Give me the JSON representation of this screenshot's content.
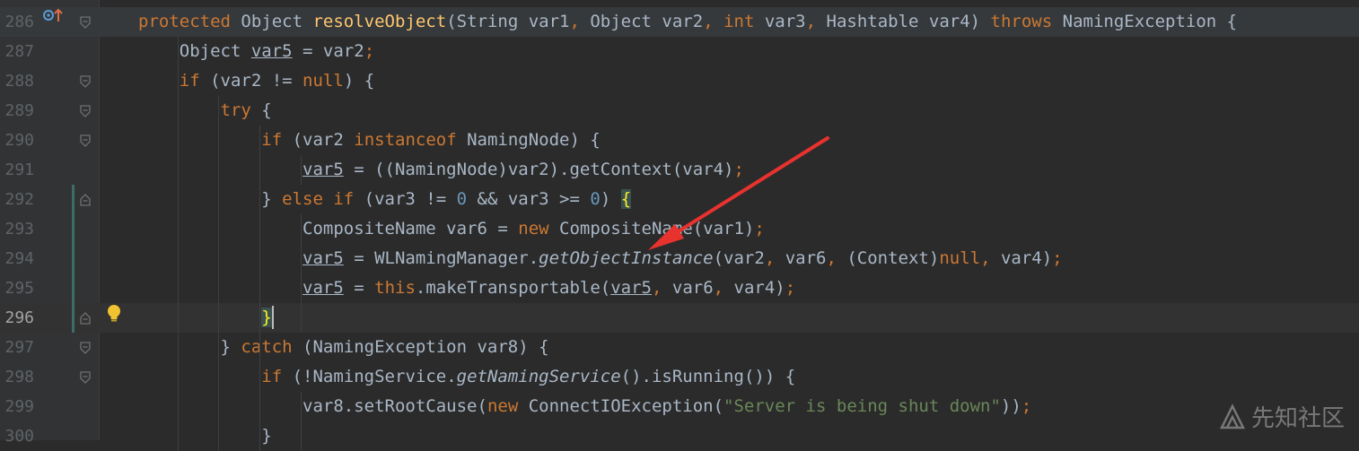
{
  "colors": {
    "background": "#2b2b2b",
    "gutter": "#313335",
    "keyword": "#cc7832",
    "function": "#ffc66d",
    "number": "#6897bb",
    "string": "#6a8759",
    "text": "#a9b7c6",
    "arrow": "#e8322e"
  },
  "lines": [
    {
      "num": "286",
      "tokens": [
        {
          "t": "protected ",
          "c": "kw"
        },
        {
          "t": "Object ",
          "c": "default"
        },
        {
          "t": "resolveObject",
          "c": "fn"
        },
        {
          "t": "(String var1",
          "c": "default"
        },
        {
          "t": ", ",
          "c": "kw"
        },
        {
          "t": "Object var2",
          "c": "default"
        },
        {
          "t": ", ",
          "c": "kw"
        },
        {
          "t": "int ",
          "c": "kw"
        },
        {
          "t": "var3",
          "c": "default"
        },
        {
          "t": ", ",
          "c": "kw"
        },
        {
          "t": "Hashtable var4) ",
          "c": "default"
        },
        {
          "t": "throws ",
          "c": "kw"
        },
        {
          "t": "NamingException {",
          "c": "default"
        }
      ]
    },
    {
      "num": "287",
      "tokens": [
        {
          "t": "    Object ",
          "c": "default"
        },
        {
          "t": "var5",
          "c": "ul"
        },
        {
          "t": " = var2",
          "c": "default"
        },
        {
          "t": ";",
          "c": "kw"
        }
      ]
    },
    {
      "num": "288",
      "tokens": [
        {
          "t": "    ",
          "c": "default"
        },
        {
          "t": "if ",
          "c": "kw"
        },
        {
          "t": "(var2 != ",
          "c": "default"
        },
        {
          "t": "null",
          "c": "kw"
        },
        {
          "t": ") {",
          "c": "default"
        }
      ]
    },
    {
      "num": "289",
      "tokens": [
        {
          "t": "        ",
          "c": "default"
        },
        {
          "t": "try ",
          "c": "kw"
        },
        {
          "t": "{",
          "c": "default"
        }
      ]
    },
    {
      "num": "290",
      "tokens": [
        {
          "t": "            ",
          "c": "default"
        },
        {
          "t": "if ",
          "c": "kw"
        },
        {
          "t": "(var2 ",
          "c": "default"
        },
        {
          "t": "instanceof ",
          "c": "kw"
        },
        {
          "t": "NamingNode) {",
          "c": "default"
        }
      ]
    },
    {
      "num": "291",
      "tokens": [
        {
          "t": "                ",
          "c": "default"
        },
        {
          "t": "var5",
          "c": "ul"
        },
        {
          "t": " = ((NamingNode)var2).getContext(var4)",
          "c": "default"
        },
        {
          "t": ";",
          "c": "kw"
        }
      ]
    },
    {
      "num": "292",
      "tokens": [
        {
          "t": "            } ",
          "c": "default"
        },
        {
          "t": "else if ",
          "c": "kw"
        },
        {
          "t": "(var3 != ",
          "c": "default"
        },
        {
          "t": "0",
          "c": "num"
        },
        {
          "t": " && var3 >= ",
          "c": "default"
        },
        {
          "t": "0",
          "c": "num"
        },
        {
          "t": ") ",
          "c": "default"
        },
        {
          "t": "{",
          "c": "match"
        }
      ]
    },
    {
      "num": "293",
      "tokens": [
        {
          "t": "                CompositeName var6 = ",
          "c": "default"
        },
        {
          "t": "new ",
          "c": "kw"
        },
        {
          "t": "CompositeName(var1)",
          "c": "default"
        },
        {
          "t": ";",
          "c": "kw"
        }
      ]
    },
    {
      "num": "294",
      "tokens": [
        {
          "t": "                ",
          "c": "default"
        },
        {
          "t": "var5",
          "c": "ul"
        },
        {
          "t": " = WLNamingManager.",
          "c": "default"
        },
        {
          "t": "getObjectInstance",
          "c": "it"
        },
        {
          "t": "(var2",
          "c": "default"
        },
        {
          "t": ", ",
          "c": "kw"
        },
        {
          "t": "var6",
          "c": "default"
        },
        {
          "t": ", ",
          "c": "kw"
        },
        {
          "t": "(Context)",
          "c": "default"
        },
        {
          "t": "null",
          "c": "kw"
        },
        {
          "t": ", ",
          "c": "kw"
        },
        {
          "t": "var4)",
          "c": "default"
        },
        {
          "t": ";",
          "c": "kw"
        }
      ]
    },
    {
      "num": "295",
      "tokens": [
        {
          "t": "                ",
          "c": "default"
        },
        {
          "t": "var5",
          "c": "ul"
        },
        {
          "t": " = ",
          "c": "default"
        },
        {
          "t": "this",
          "c": "kw"
        },
        {
          "t": ".makeTransportable(",
          "c": "default"
        },
        {
          "t": "var5",
          "c": "ul"
        },
        {
          "t": ", ",
          "c": "kw"
        },
        {
          "t": "var6",
          "c": "default"
        },
        {
          "t": ", ",
          "c": "kw"
        },
        {
          "t": "var4)",
          "c": "default"
        },
        {
          "t": ";",
          "c": "kw"
        }
      ]
    },
    {
      "num": "296",
      "tokens": [
        {
          "t": "            ",
          "c": "default"
        },
        {
          "t": "}",
          "c": "match"
        }
      ]
    },
    {
      "num": "297",
      "tokens": [
        {
          "t": "        } ",
          "c": "default"
        },
        {
          "t": "catch ",
          "c": "kw"
        },
        {
          "t": "(NamingException var8) {",
          "c": "default"
        }
      ]
    },
    {
      "num": "298",
      "tokens": [
        {
          "t": "            ",
          "c": "default"
        },
        {
          "t": "if ",
          "c": "kw"
        },
        {
          "t": "(!NamingService.",
          "c": "default"
        },
        {
          "t": "getNamingService",
          "c": "it"
        },
        {
          "t": "().isRunning()) {",
          "c": "default"
        }
      ]
    },
    {
      "num": "299",
      "tokens": [
        {
          "t": "                var8.setRootCause(",
          "c": "default"
        },
        {
          "t": "new ",
          "c": "kw"
        },
        {
          "t": "ConnectIOException(",
          "c": "default"
        },
        {
          "t": "\"Server is being shut down\"",
          "c": "str"
        },
        {
          "t": "))",
          "c": "default"
        },
        {
          "t": ";",
          "c": "kw"
        }
      ]
    },
    {
      "num": "300",
      "tokens": [
        {
          "t": "            }",
          "c": "default"
        }
      ]
    }
  ],
  "watermark": {
    "text": "先知社区"
  }
}
